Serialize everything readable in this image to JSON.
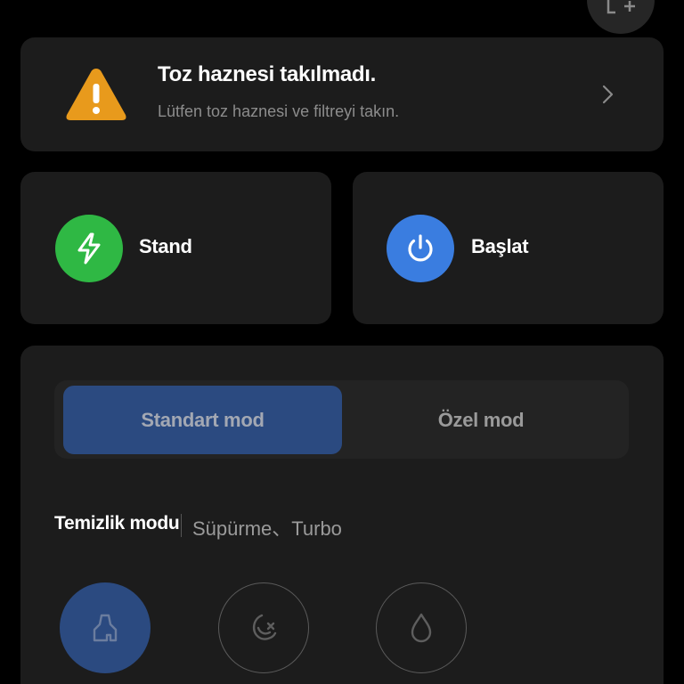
{
  "alert": {
    "title": "Toz haznesi takılmadı.",
    "subtitle": "Lütfen toz haznesi ve filtreyi takın.",
    "icon": "warning-triangle-icon",
    "color": "#e89a1c"
  },
  "actions": {
    "stand": {
      "label": "Stand",
      "icon": "lightning-icon",
      "color": "#2fb844"
    },
    "start": {
      "label": "Başlat",
      "icon": "power-icon",
      "color": "#3a7de0"
    }
  },
  "mode_tabs": [
    {
      "label": "Standart mod",
      "selected": true
    },
    {
      "label": "Özel mod",
      "selected": false
    }
  ],
  "cleaning": {
    "label": "Temizlik modu",
    "value": "Süpürme、Turbo",
    "modes": [
      {
        "icon": "sweep-icon",
        "selected": true
      },
      {
        "icon": "vacuum-icon",
        "selected": false
      },
      {
        "icon": "mop-drop-icon",
        "selected": false
      }
    ]
  },
  "colors": {
    "background": "#000000",
    "card": "#1c1c1c",
    "accent": "#2b4a80"
  }
}
